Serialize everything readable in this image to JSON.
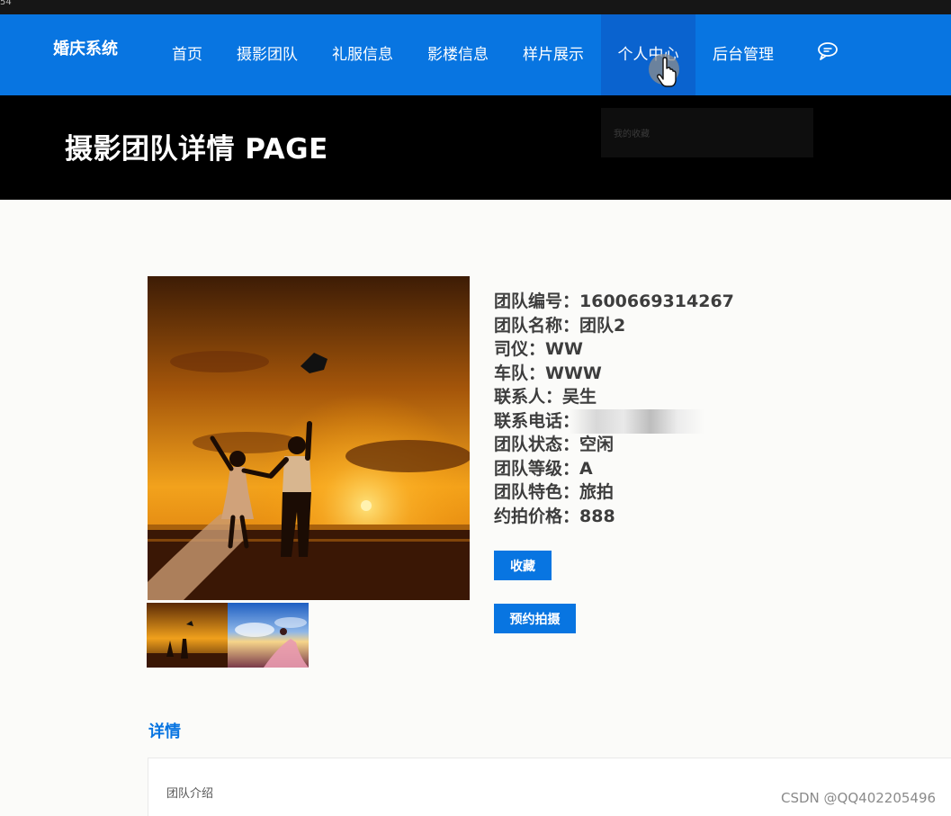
{
  "topstrip": {
    "text": "54"
  },
  "brand": {
    "name": "婚庆系统"
  },
  "nav": {
    "items": [
      "首页",
      "摄影团队",
      "礼服信息",
      "影楼信息",
      "样片展示",
      "个人中心",
      "后台管理"
    ],
    "active": "个人中心",
    "chat_icon": "chat-bubble-icon"
  },
  "dropdown": {
    "items": [
      "我的收藏"
    ]
  },
  "hero": {
    "title": "摄影团队详情 PAGE"
  },
  "team": {
    "fields": [
      {
        "label": "团队编号：",
        "value": "1600669314267"
      },
      {
        "label": "团队名称：",
        "value": "团队2"
      },
      {
        "label": "司仪：",
        "value": "WW"
      },
      {
        "label": "车队：",
        "value": "WWW"
      },
      {
        "label": "联系人：",
        "value": "吴生"
      },
      {
        "label": "联系电话：",
        "value": ""
      },
      {
        "label": "团队状态：",
        "value": "空闲"
      },
      {
        "label": "团队等级：",
        "value": "A"
      },
      {
        "label": "团队特色：",
        "value": "旅拍"
      },
      {
        "label": "约拍价格：",
        "value": "888"
      }
    ]
  },
  "buttons": {
    "favorite": "收藏",
    "book": "预约拍摄"
  },
  "detail": {
    "title": "详情",
    "intro_label": "团队介绍"
  },
  "watermark": {
    "text": "CSDN @QQ402205496"
  },
  "colors": {
    "primary": "#0875e1",
    "hero_bg": "#000000",
    "text": "#3d3d3d"
  }
}
